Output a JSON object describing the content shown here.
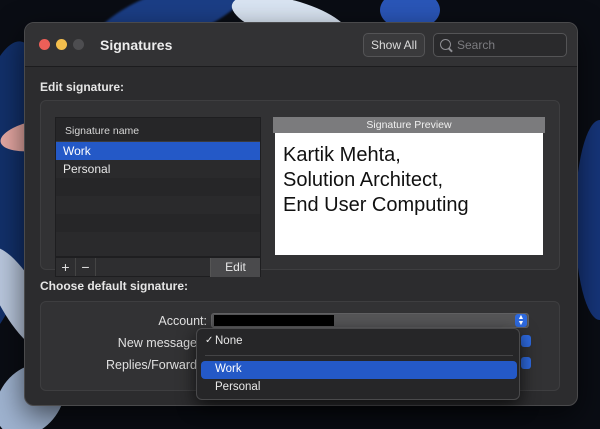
{
  "window": {
    "title": "Signatures",
    "show_all_label": "Show All",
    "search_placeholder": "Search"
  },
  "edit_section": {
    "label": "Edit signature:",
    "list_header": "Signature name",
    "signatures": [
      "Work",
      "Personal"
    ],
    "selected_index": 0,
    "add_label": "+",
    "remove_label": "−",
    "edit_label": "Edit",
    "preview_header": "Signature Preview",
    "preview_lines": [
      "Kartik Mehta,",
      "Solution Architect,",
      "End User Computing"
    ]
  },
  "default_section": {
    "label": "Choose default signature:",
    "account_label": "Account:",
    "new_message_label": "New message",
    "replies_label": "Replies/Forward"
  },
  "menu": {
    "items": [
      "None",
      "Work",
      "Personal"
    ],
    "checked_index": 0,
    "highlighted_index": 1
  },
  "colors": {
    "accent": "#2459c7",
    "window_bg": "#2c2c2e",
    "close": "#ec5f58",
    "minimize": "#f3be4d"
  }
}
